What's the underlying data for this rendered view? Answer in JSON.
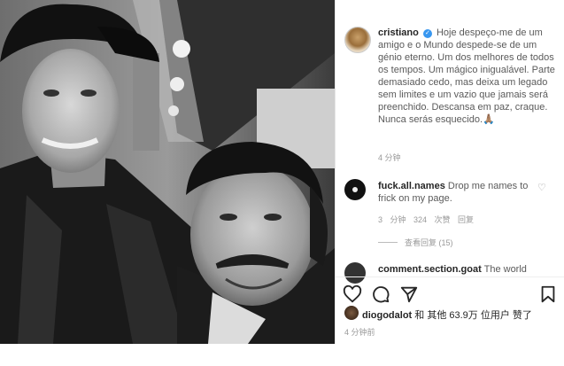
{
  "post": {
    "username": "cristiano",
    "verified_mark": "✓",
    "caption": "Hoje despeço-me de um amigo e o Mundo despede-se de um génio eterno. Um dos melhores de todos os tempos. Um mágico inigualável. Parte demasiado cedo, mas deixa um legado sem limites e um vazio que jamais será preenchido. Descansa em paz, craque. Nunca serás esquecido.🙏🏽",
    "time": "4 分钟"
  },
  "comments": [
    {
      "username": "fuck.all.names",
      "text": "Drop me names to frick on my page.",
      "meta": "3 分钟 324 次赞 回复",
      "replies": "查看回复 (15)",
      "heart_icon": "heart-outline-icon"
    },
    {
      "username": "comment.section.goat",
      "text": "The world"
    }
  ],
  "actions": {
    "icons": [
      "heart-icon",
      "comment-icon",
      "share-icon",
      "bookmark-icon"
    ]
  },
  "likes": {
    "user": "diogodalot",
    "text": "和 其他 63.9万 位用户 赞了"
  },
  "footer": {
    "time": "4 分钟前"
  }
}
